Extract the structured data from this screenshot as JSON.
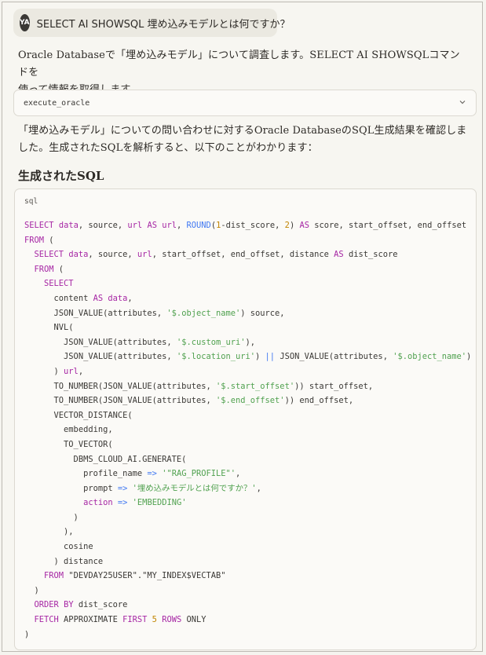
{
  "user_message": {
    "avatar_initials": "YA",
    "text": "SELECT AI SHOWSQL 埋め込みモデルとは何ですか？"
  },
  "assistant": {
    "intro_line1": "Oracle Databaseで「埋め込みモデル」について調査します。SELECT AI SHOWSQLコマンドを",
    "intro_line2": "使って情報を取得します。",
    "tool_call": {
      "name": "execute_oracle",
      "icon": "chevron-down-icon"
    },
    "result_line1": "「埋め込みモデル」についての問い合わせに対するOracle DatabaseのSQL生成結果を確認しま",
    "result_line2": "した。生成されたSQLを解析すると、以下のことがわかります：",
    "section_heading": "生成されたSQL"
  },
  "code_block": {
    "language": "sql",
    "lines": [
      "SELECT data, source, url AS url, ROUND(1-dist_score, 2) AS score, start_offset, end_offset",
      "FROM (",
      "  SELECT data, source, url, start_offset, end_offset, distance AS dist_score",
      "  FROM (",
      "    SELECT",
      "      content AS data,",
      "      JSON_VALUE(attributes, '$.object_name') source,",
      "      NVL(",
      "        JSON_VALUE(attributes, '$.custom_uri'),",
      "        JSON_VALUE(attributes, '$.location_uri') || JSON_VALUE(attributes, '$.object_name')",
      "      ) url,",
      "      TO_NUMBER(JSON_VALUE(attributes, '$.start_offset')) start_offset,",
      "      TO_NUMBER(JSON_VALUE(attributes, '$.end_offset')) end_offset,",
      "      VECTOR_DISTANCE(",
      "        embedding,",
      "        TO_VECTOR(",
      "          DBMS_CLOUD_AI.GENERATE(",
      "            profile_name => '\"RAG_PROFILE\"',",
      "            prompt => '埋め込みモデルとは何ですか？',",
      "            action => 'EMBEDDING'",
      "          )",
      "        ),",
      "        cosine",
      "      ) distance",
      "    FROM \"DEVDAY25USER\".\"MY_INDEX$VECTAB\"",
      "  )",
      "  ORDER BY dist_score",
      "  FETCH APPROXIMATE FIRST 5 ROWS ONLY",
      ")"
    ]
  }
}
